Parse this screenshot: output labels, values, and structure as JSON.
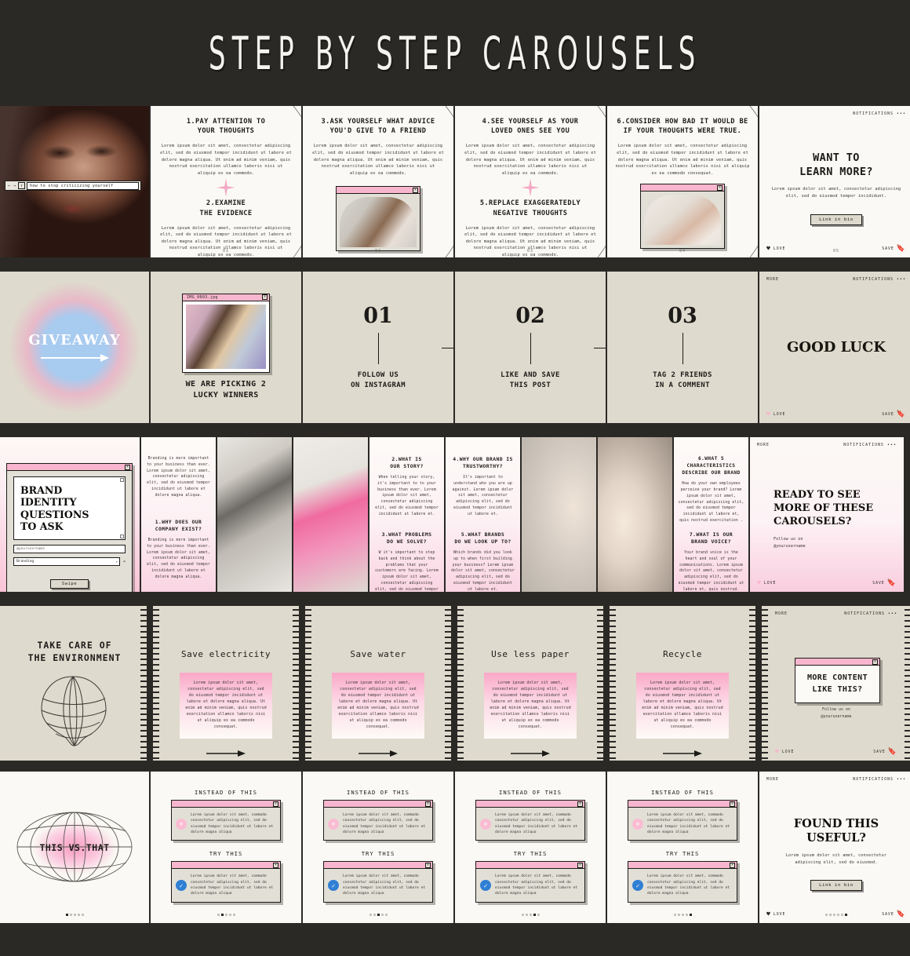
{
  "header": {
    "title": "STEP BY STEP CAROUSELS"
  },
  "lorem": {
    "full": "Lorem ipsum dolor sit amet, consectetur adipiscing elit, sed do eiusmod tempor incididunt ut labore et dolore magna aliqua. Ut enim ad minim veniam, quis nostrud exercitation ullamco laboris nisi ut aliquip ex ea commodo.",
    "full_consequat": "Lorem ipsum dolor sit amet, consectetur adipiscing elit, sed do eiusmod tempor incididunt ut labore et dolore magna aliqua. Ut enim ad minim veniam, quis nostrud exercitation ullamco laboris nisi ut aliquip ex ea commodo consequat.",
    "short": "Lorem ipsum dolor sit amet, consectetur adipiscing elit, sed do eiusmod tempor incididunt.",
    "shorter": "Lorem ipsum dolor sit amet, consectetur adipiscing elit, sed do eiusmod.",
    "cmp": "Lorem ipsum dolor sit amet, commodo consectetur adipiscing elit, sed do eiusmod tempor incididunt ut labore et dolore magna aliqua"
  },
  "row1": {
    "cover": {
      "search_value": "how to stop criticizing yourself",
      "nav_back": "←",
      "nav_fwd": "→",
      "nav_up": "↑"
    },
    "slides": [
      {
        "page": "01",
        "title_a": "1.PAY ATTENTION TO\nYOUR THOUGHTS",
        "title_b": "2.EXAMINE\nTHE EVIDENCE"
      },
      {
        "page": "02",
        "title_a": "3.ASK YOURSELF WHAT ADVICE\nYOU'D GIVE TO A FRIEND"
      },
      {
        "page": "03",
        "title_a": "4.SEE YOURSELF AS YOUR\nLOVED ONES SEE YOU",
        "title_b": "5.REPLACE EXAGGERATEDLY\nNEGATIVE THOUGHTS"
      },
      {
        "page": "04",
        "title_a": "6.CONSIDER HOW BAD IT WOULD BE\nIF YOUR THOUGHTS WERE TRUE."
      },
      {
        "page": "05",
        "notifications": "NOTIFICATIONS",
        "cta_title": "WANT TO\nLEARN MORE?",
        "cta_button": "Link in bio",
        "love": "LOVE",
        "save": "SAVE"
      }
    ]
  },
  "row2": {
    "giveaway_title": "GIVEAWAY",
    "photo_window_title": "IMG_0003.jpg",
    "winners_caption": "WE ARE PICKING 2\nLUCKY WINNERS",
    "steps": [
      {
        "number": "01",
        "label": "FOLLOW US\nON INSTAGRAM"
      },
      {
        "number": "02",
        "label": "LIKE AND SAVE\nTHIS POST"
      },
      {
        "number": "03",
        "label": "TAG 2 FRIENDS\nIN A COMMENT"
      }
    ],
    "end": {
      "more": "MORE",
      "notifications": "NOTIFICATIONS",
      "title": "GOOD LUCK",
      "love": "LOVE",
      "save": "SAVE"
    }
  },
  "row3": {
    "cover": {
      "window_title": "",
      "heading": "BRAND IDENTITY\nQUESTIONS\nTO ASK",
      "field_username": "@yourusername",
      "field_topic": "Branding",
      "button": "Swipe"
    },
    "intro": "Branding is more important to your business than ever. Lorem ipsum dolor sit amet, consectetur adipiscing elit, sed do eiusmod tempor incididunt ut labore et dolore magna aliqua.",
    "questions": [
      {
        "title": "1.WHY DOES OUR\nCOMPANY EXIST?",
        "body": "Branding is more important to your business than ever. Lorem ipsum dolor sit amet, consectetur adipiscing elit, sed do eiusmod tempor incididunt ut labore et dolore magna aliqua."
      },
      {
        "title": "2.WHAT IS\nOUR STORY?",
        "body": "When telling your story, it's important to to your business than ever. Lorem ipsum dolor sit amet, consectetur adipiscing elit, sed do eiusmod tempor incididunt ut labore et."
      },
      {
        "title": "3.WHAT PROBLEMS\nDO WE SOLVE?",
        "body": "W it's important to step back and think about the problems that your customers are facing. Lorem ipsum dolor sit amet, consectetur adipiscing elit, sed do eiusmod tempor incididunt."
      },
      {
        "title": "4.WHY OUR BRAND IS\nTRUSTWORTHY?",
        "body": "It's important to understand who you are up against. Lorem ipsum dolor sit amet, consectetur adipiscing elit, sed do eiusmod tempor incididunt ut labore et."
      },
      {
        "title": "5.WHAT BRANDS\nDO WE LOOK UP TO?",
        "body": "Which brands did you look up to when first building your business? Lorem ipsum dolor sit amet, consectetur adipiscing elit, sed do eiusmod tempor incididunt ut labore et."
      },
      {
        "title": "6.WHAT 5 CHARACTERISTICS\nDESCRIBE OUR BRAND",
        "body": "How do your own employees perceive your brand? Lorem ipsum dolor sit amet, consectetur adipiscing elit, sed do eiusmod tempor incididunt ut labore et, quis nostrud exercitation ."
      },
      {
        "title": "7.WHAT IS OUR\nBRAND VOICE?",
        "body": "Your brand voice is the heart and soul of your communications. Lorem ipsum dolor sit amet, consectetur adipiscing elit, sed do eiusmod tempor incididunt ut labore et, quis nostrud."
      }
    ],
    "end": {
      "more": "MORE",
      "notifications": "NOTIFICATIONS",
      "title": "READY TO SEE\nMORE OF THESE\nCAROUSELS?",
      "follow": "Follow us on\n@yourusername",
      "love": "LOVE",
      "save": "SAVE"
    }
  },
  "row4": {
    "cover_title": "TAKE CARE OF\nTHE ENVIRONMENT",
    "tips": [
      {
        "title": "Save electricity"
      },
      {
        "title": "Save water"
      },
      {
        "title": "Use less paper"
      },
      {
        "title": "Recycle"
      }
    ],
    "end": {
      "more": "MORE",
      "notifications": "NOTIFICATIONS",
      "window_title": "MORE CONTENT\nLIKE THIS?",
      "follow": "Follow us on\n@yourusername",
      "love": "LOVE",
      "save": "SAVE"
    }
  },
  "row5": {
    "cover_title": "THIS VS.THAT",
    "instead_label": "INSTEAD OF THIS",
    "try_label": "TRY THIS",
    "end": {
      "more": "MORE",
      "notifications": "NOTIFICATIONS",
      "title": "FOUND THIS\nUSEFUL?",
      "button": "Link in bio",
      "love": "LOVE",
      "save": "SAVE"
    }
  },
  "colors": {
    "dark": "#2b2926",
    "cream": "#faf9f5",
    "beige": "#dedacd",
    "pink": "#f8b6ce",
    "blue": "#2f7fd4"
  }
}
